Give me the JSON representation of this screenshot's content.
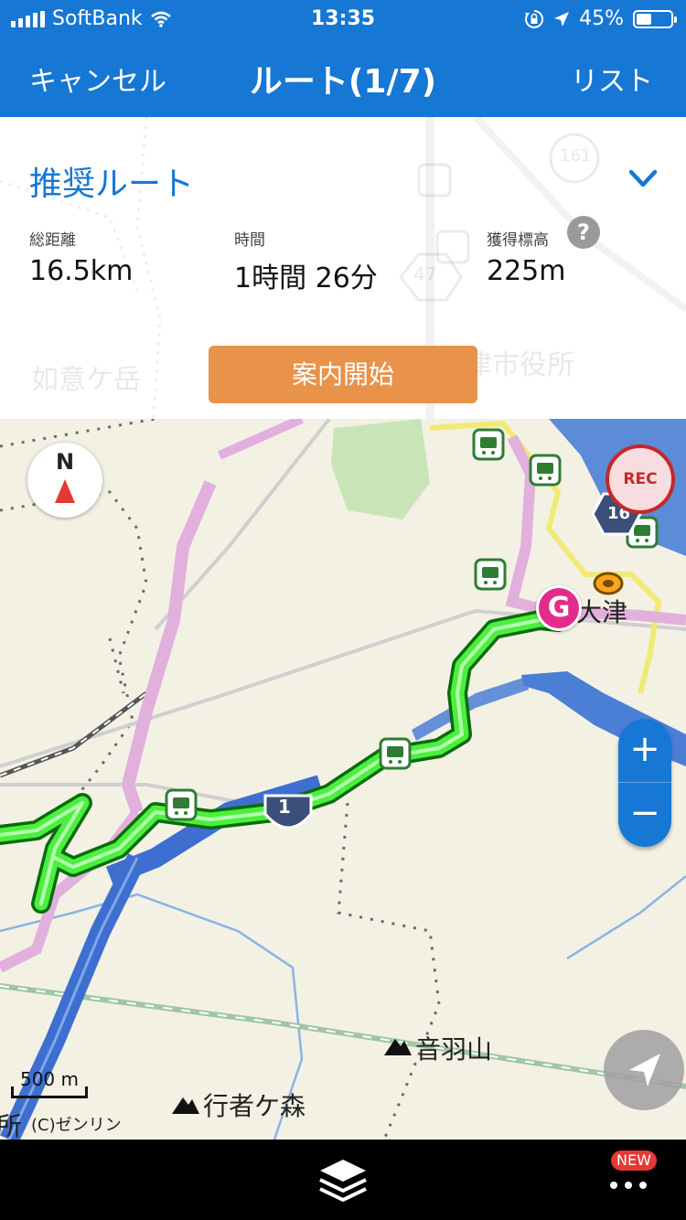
{
  "status": {
    "carrier": "SoftBank",
    "time": "13:35",
    "battery": "45%",
    "battery_level": 0.45
  },
  "nav": {
    "cancel": "キャンセル",
    "title": "ルート(1/7)",
    "list": "リスト"
  },
  "route": {
    "name": "推奨ルート",
    "distance_label": "総距離",
    "distance": "16.5km",
    "time_label": "時間",
    "time": "1時間 26分",
    "elevation_label": "獲得標高",
    "elevation": "225m",
    "help": "?",
    "start_button": "案内開始"
  },
  "behind_card": {
    "mountain": "如意ケ岳",
    "city_hall": "大津市役所",
    "route_161": "161",
    "route_47": "47"
  },
  "map": {
    "compass": "N",
    "rec": "REC",
    "zoom_in": "+",
    "zoom_out": "−",
    "goal": "G",
    "station": "大津",
    "route_1": "1",
    "route_16": "16",
    "mountain1": "音羽山",
    "mountain2": "行者ケ森",
    "edge_text": "所",
    "scale": "500 m",
    "credit": "(C)ゼンリン"
  },
  "bottom": {
    "new_badge": "NEW"
  },
  "colors": {
    "primary": "#1677d4",
    "route_line": "#4cef3e",
    "start_button": "#e8924a",
    "goal_marker": "#e32c8a",
    "rec": "#c62828"
  }
}
